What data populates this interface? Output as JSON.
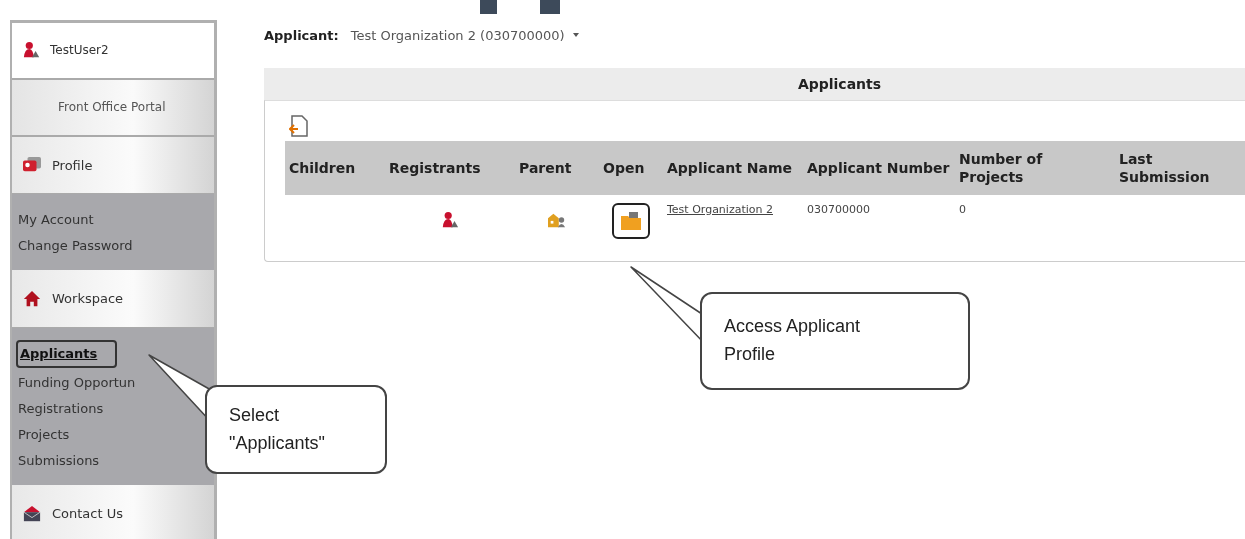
{
  "sidebar": {
    "user": "TestUser2",
    "portal": "Front Office Portal",
    "sections": [
      {
        "label": "Profile",
        "kind": "profile",
        "items": [
          {
            "label": "My Account",
            "selected": false
          },
          {
            "label": "Change Password",
            "selected": false
          }
        ]
      },
      {
        "label": "Workspace",
        "kind": "home",
        "items": [
          {
            "label": "Applicants",
            "selected": true
          },
          {
            "label": "Funding Opportun",
            "selected": false
          },
          {
            "label": "Registrations",
            "selected": false
          },
          {
            "label": "Projects",
            "selected": false
          },
          {
            "label": "Submissions",
            "selected": false
          }
        ]
      },
      {
        "label": "Contact Us",
        "kind": "mail"
      }
    ]
  },
  "applicant": {
    "label": "Applicant:",
    "value": "Test Organization 2 (030700000)"
  },
  "panel": {
    "title": "Applicants",
    "columns": [
      "Children",
      "Registrants",
      "Parent",
      "Open",
      "Applicant Name",
      "Applicant Number",
      "Number of Projects",
      "Last Submission"
    ],
    "rows": [
      {
        "name": "Test Organization 2",
        "number": "030700000",
        "projects": "0",
        "open_highlighted": true
      }
    ]
  },
  "callouts": [
    {
      "kind": "menu",
      "text": "Select \"Applicants\""
    },
    {
      "kind": "table",
      "text": "Access Applicant Profile"
    }
  ]
}
